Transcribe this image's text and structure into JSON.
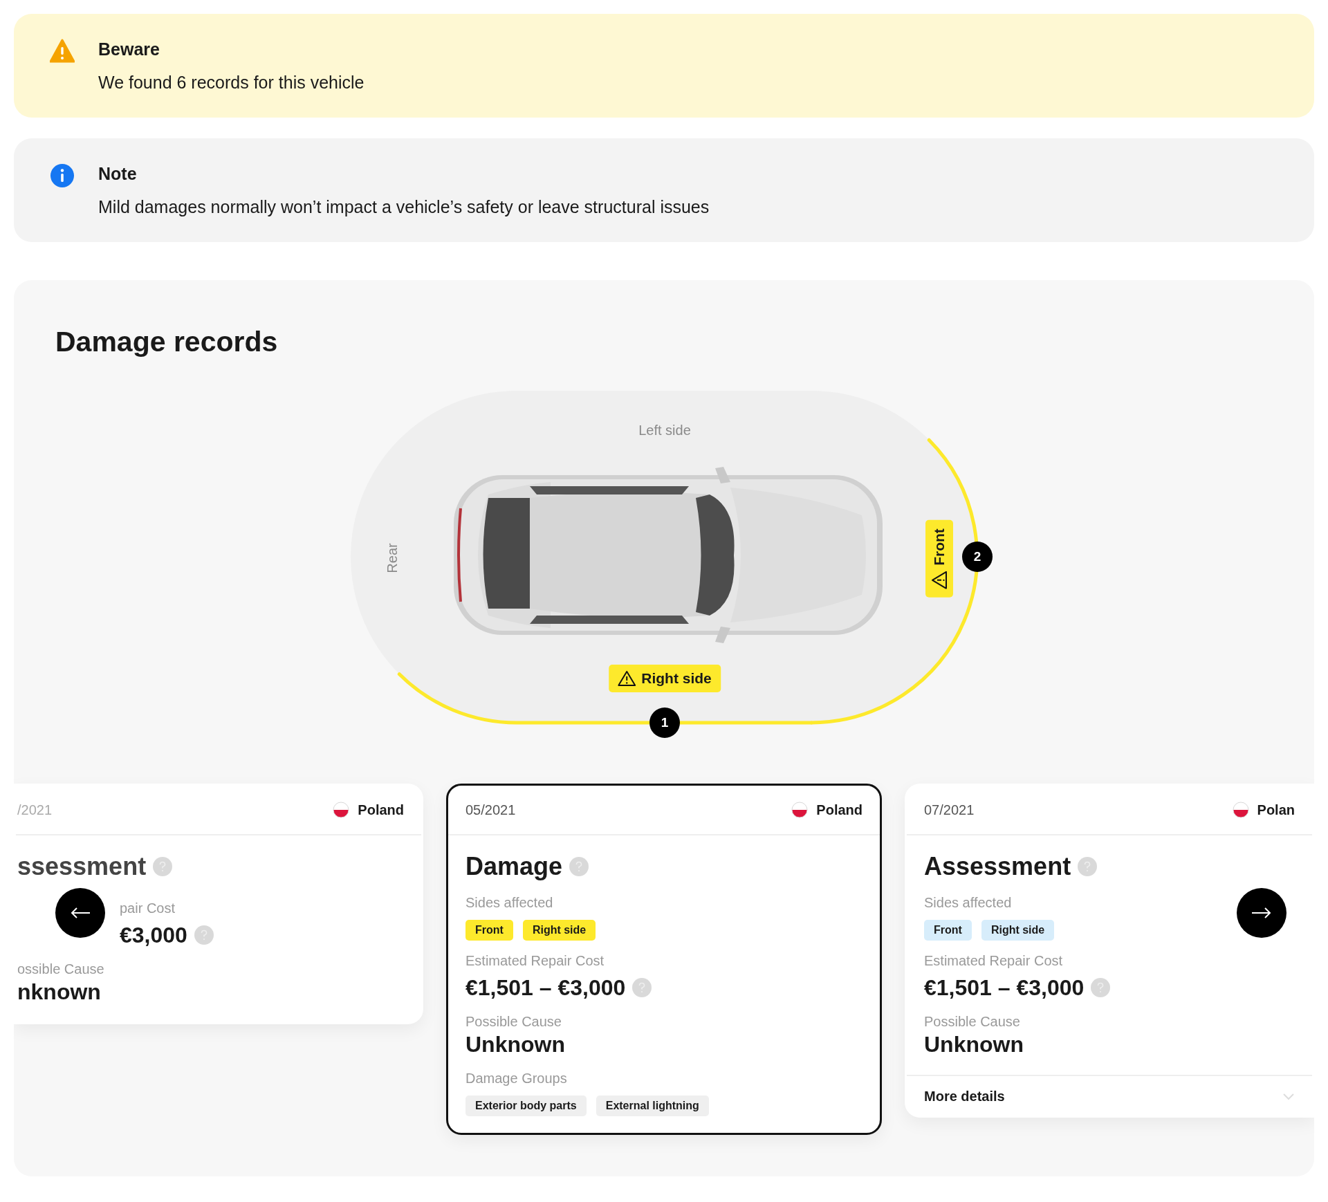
{
  "alerts": [
    {
      "kind": "warning",
      "title": "Beware",
      "message": "We found 6 records for this vehicle"
    },
    {
      "kind": "info",
      "title": "Note",
      "message": "Mild damages normally won’t impact a vehicle’s safety or leave structural issues"
    }
  ],
  "damage_records": {
    "title": "Damage records",
    "diagram": {
      "labels": [
        {
          "text": "Left side",
          "kind": "left"
        },
        {
          "text": "Rear",
          "kind": "rear"
        }
      ],
      "affected": [
        {
          "text": "Right side",
          "kind": "right",
          "marker": "1"
        },
        {
          "text": "Front",
          "kind": "front",
          "marker": "2"
        }
      ]
    },
    "cards": [
      {
        "kind": "clipped",
        "selected": false,
        "date": "/2021",
        "country": "Poland",
        "title": "ssessment",
        "cost_label": "pair Cost",
        "cost": "€3,000",
        "cause_label": "ossible Cause",
        "cause": "nknown"
      },
      {
        "kind": "full",
        "selected": true,
        "date": "05/2021",
        "country": "Poland",
        "title": "Damage",
        "sides_label": "Sides affected",
        "sides": [
          "Front",
          "Right side"
        ],
        "cost_label": "Estimated Repair Cost",
        "cost": "€1,501 – €3,000",
        "cause_label": "Possible Cause",
        "cause": "Unknown",
        "groups_label": "Damage Groups",
        "groups": [
          "Exterior body parts",
          "External lightning"
        ]
      },
      {
        "kind": "full",
        "selected": false,
        "date": "07/2021",
        "country": "Polan",
        "title": "Assessment",
        "sides_label": "Sides affected",
        "sides": [
          "Front",
          "Right side"
        ],
        "cost_label": "Estimated Repair Cost",
        "cost": "€1,501 – €3,000",
        "cause_label": "Possible Cause",
        "cause": "Unknown",
        "more": "More details"
      }
    ]
  }
}
